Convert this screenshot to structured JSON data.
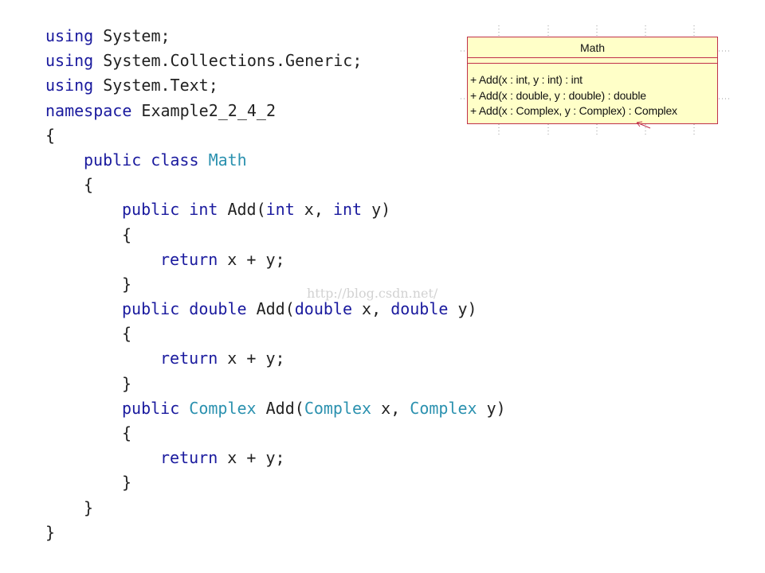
{
  "code": {
    "line1": {
      "kw": "using",
      "rest": " System;"
    },
    "line2": {
      "kw": "using",
      "rest": " System.Collections.Generic;"
    },
    "line3": {
      "kw": "using",
      "rest": " System.Text;"
    },
    "line4": {
      "kw": "namespace",
      "rest": " Example2_2_4_2"
    },
    "line5": {
      "text": "{"
    },
    "line6": {
      "kw1": "public",
      "kw2": "class",
      "type": "Math"
    },
    "line7": {
      "text": "{"
    },
    "line8": {
      "kw1": "public",
      "kw2": "int",
      "name": "Add(",
      "p1type": "int",
      "p1name": " x, ",
      "p2type": "int",
      "p2name": " y)"
    },
    "line9": {
      "text": "{"
    },
    "line10": {
      "kw": "return",
      "rest": " x + y;"
    },
    "line11": {
      "text": "}"
    },
    "line12": {
      "kw1": "public",
      "kw2": "double",
      "name": "Add(",
      "p1type": "double",
      "p1name": " x, ",
      "p2type": "double",
      "p2name": " y)"
    },
    "line13": {
      "text": "{"
    },
    "line14": {
      "kw": "return",
      "rest": " x + y;"
    },
    "line15": {
      "text": "}"
    },
    "line16": {
      "kw1": "public",
      "type": "Complex",
      "name": "Add(",
      "p1type": "Complex",
      "p1name": " x, ",
      "p2type": "Complex",
      "p2name": " y)"
    },
    "line17": {
      "text": "{"
    },
    "line18": {
      "kw": "return",
      "rest": " x + y;"
    },
    "line19": {
      "text": "}"
    },
    "line20": {
      "text": "}"
    },
    "line21": {
      "text": "}"
    }
  },
  "watermark": "http://blog.csdn.net/",
  "uml": {
    "class_name": "Math",
    "operations": [
      "+ Add(x : int, y : int) : int",
      "+ Add(x : double, y : double) : double",
      "+ Add(x : Complex, y : Complex) : Complex"
    ]
  },
  "colors": {
    "keyword": "#1a1a9e",
    "type": "#2b91af",
    "text": "#222222",
    "uml_fill": "#ffffc8",
    "uml_border": "#c0304a"
  }
}
